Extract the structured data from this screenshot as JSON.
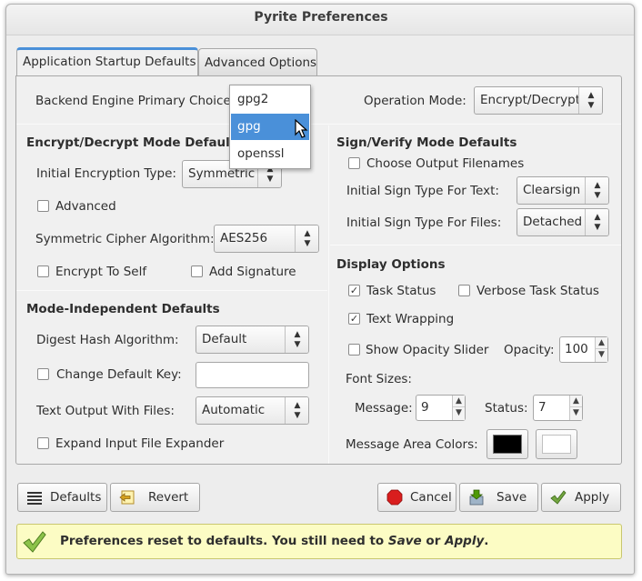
{
  "window": {
    "title": "Pyrite Preferences"
  },
  "tabs": [
    {
      "label": "Application Startup Defaults",
      "active": true
    },
    {
      "label": "Advanced Options",
      "active": false
    }
  ],
  "backend": {
    "label": "Backend Engine Primary Choice:",
    "options": [
      "gpg2",
      "gpg",
      "openssl"
    ],
    "highlighted": "gpg"
  },
  "operation_mode": {
    "label": "Operation Mode:",
    "value": "Encrypt/Decrypt"
  },
  "encrypt_section": {
    "title": "Encrypt/Decrypt Mode Defaults",
    "enc_type_label": "Initial Encryption Type:",
    "enc_type_value": "Symmetric",
    "advanced_label": "Advanced",
    "cipher_label": "Symmetric Cipher Algorithm:",
    "cipher_value": "AES256",
    "encrypt_to_self_label": "Encrypt To Self",
    "add_signature_label": "Add Signature"
  },
  "independent_section": {
    "title": "Mode-Independent Defaults",
    "digest_label": "Digest Hash Algorithm:",
    "digest_value": "Default",
    "change_key_label": "Change Default Key:",
    "change_key_value": "",
    "text_output_label": "Text Output With Files:",
    "text_output_value": "Automatic",
    "expand_label": "Expand Input File Expander"
  },
  "sign_section": {
    "title": "Sign/Verify Mode Defaults",
    "choose_output_label": "Choose Output Filenames",
    "sign_text_label": "Initial Sign Type For Text:",
    "sign_text_value": "Clearsign",
    "sign_files_label": "Initial Sign Type For Files:",
    "sign_files_value": "Detached"
  },
  "display_section": {
    "title": "Display Options",
    "task_status_label": "Task Status",
    "task_status_checked": true,
    "verbose_label": "Verbose Task Status",
    "verbose_checked": false,
    "wrap_label": "Text Wrapping",
    "wrap_checked": true,
    "opacity_slider_label": "Show Opacity Slider",
    "opacity_label": "Opacity:",
    "opacity_value": "100",
    "font_sizes_label": "Font Sizes:",
    "message_label": "Message:",
    "message_value": "9",
    "status_label": "Status:",
    "status_value": "7",
    "colors_label": "Message Area Colors:",
    "fg_color": "#000000",
    "bg_color": "#ffffff"
  },
  "buttons": {
    "defaults": "Defaults",
    "revert": "Revert",
    "cancel": "Cancel",
    "save": "Save",
    "apply": "Apply"
  },
  "infobar": {
    "text_before": "Preferences reset to defaults. You still need to ",
    "save_word": "Save",
    "or_word": " or ",
    "apply_word": "Apply",
    "text_after": "."
  },
  "colors": {
    "accent": "#4a90d9",
    "info_bg": "#fcfcc4",
    "check_green": "#6aa84f"
  }
}
